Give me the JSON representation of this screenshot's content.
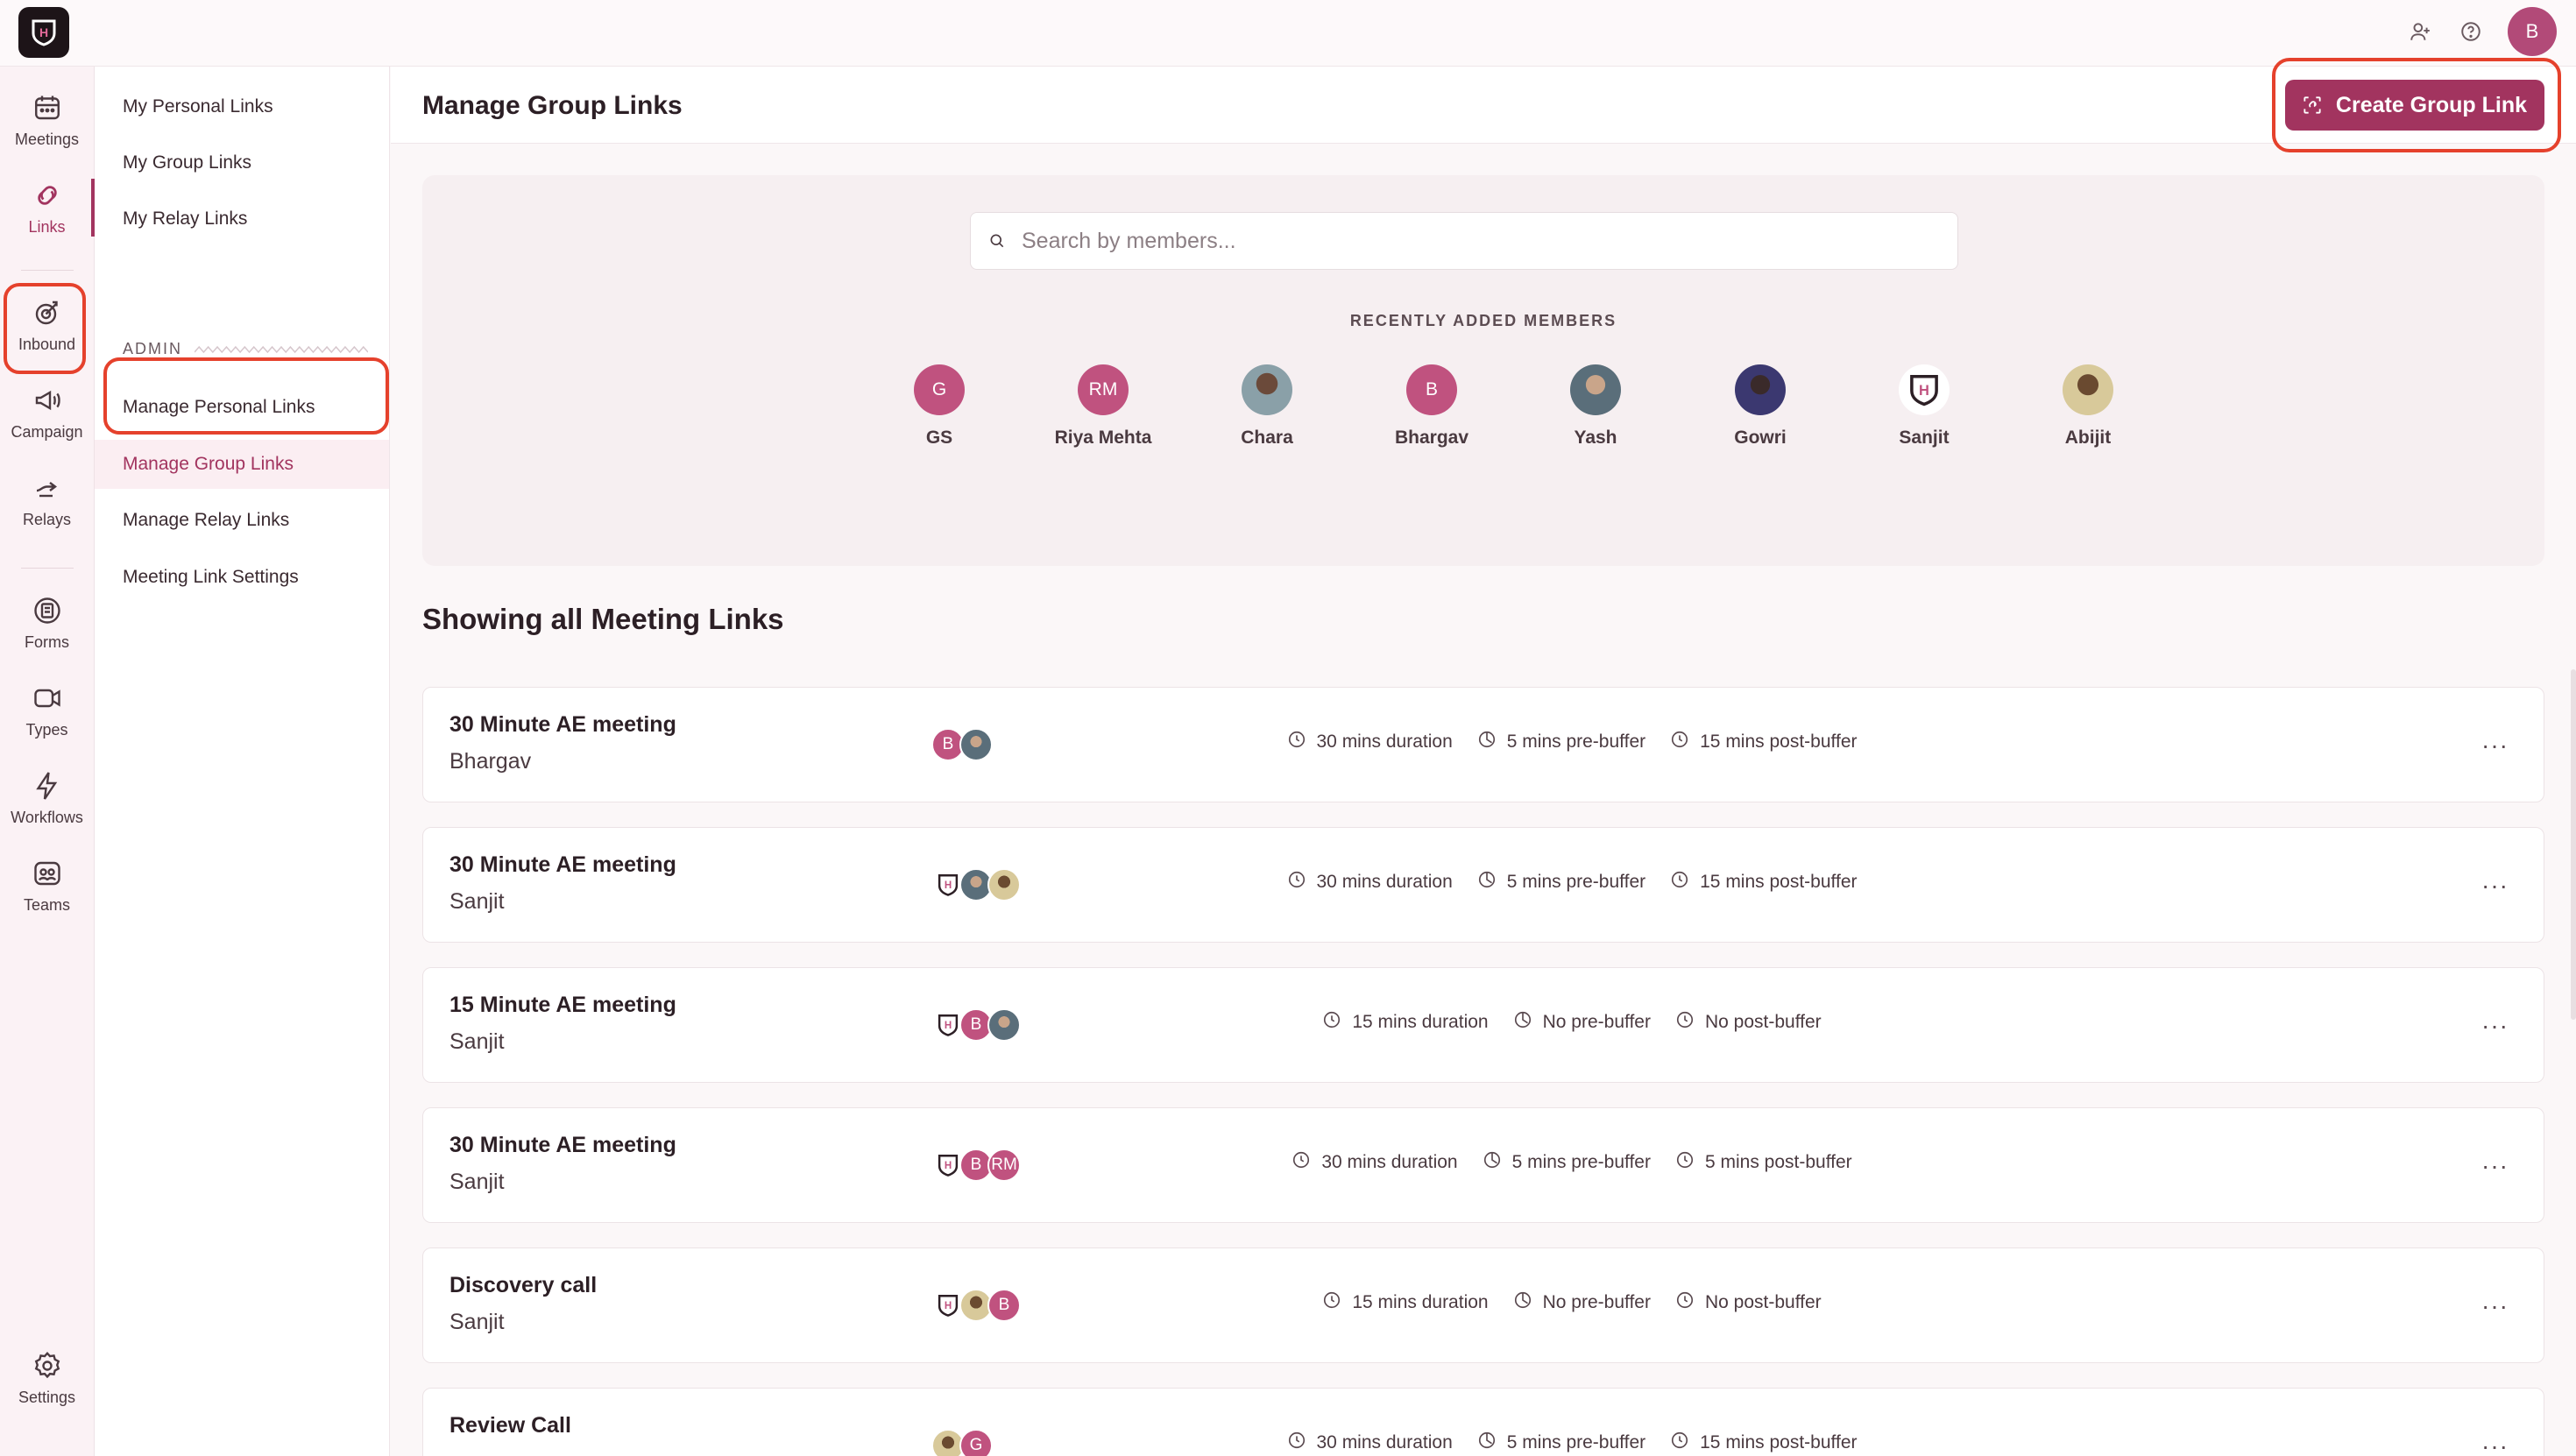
{
  "topbar": {
    "profile_initial": "B"
  },
  "rail": [
    {
      "label": "Meetings",
      "icon": "calendar-icon"
    },
    {
      "label": "Links",
      "icon": "link-icon",
      "active": true
    },
    {
      "label": "Inbound",
      "icon": "inbound-icon"
    },
    {
      "label": "Campaign",
      "icon": "megaphone-icon"
    },
    {
      "label": "Relays",
      "icon": "relay-icon"
    },
    {
      "label": "Forms",
      "icon": "forms-icon"
    },
    {
      "label": "Types",
      "icon": "video-icon"
    },
    {
      "label": "Workflows",
      "icon": "lightning-icon"
    },
    {
      "label": "Teams",
      "icon": "teams-icon"
    },
    {
      "label": "Settings",
      "icon": "gear-icon"
    }
  ],
  "subnav": {
    "items": [
      "My Personal Links",
      "My Group Links",
      "My Relay Links"
    ],
    "admin_label": "ADMIN",
    "admin_items": [
      "Manage Personal Links",
      "Manage Group Links",
      "Manage Relay Links",
      "Meeting Link Settings"
    ]
  },
  "header": {
    "title": "Manage Group Links",
    "create_label": "Create Group Link"
  },
  "search": {
    "placeholder": "Search by members..."
  },
  "recent": {
    "label": "RECENTLY ADDED MEMBERS",
    "members": [
      {
        "name": "GS",
        "initials": "G",
        "style": "pink"
      },
      {
        "name": "Riya Mehta",
        "initials": "RM",
        "style": "pink"
      },
      {
        "name": "Chara",
        "initials": "",
        "style": "photo1"
      },
      {
        "name": "Bhargav",
        "initials": "B",
        "style": "pink"
      },
      {
        "name": "Yash",
        "initials": "",
        "style": "photo2"
      },
      {
        "name": "Gowri",
        "initials": "",
        "style": "photo3"
      },
      {
        "name": "Sanjit",
        "initials": "",
        "style": "logoav"
      },
      {
        "name": "Abijit",
        "initials": "",
        "style": "photo4"
      }
    ]
  },
  "links_section_title": "Showing all Meeting Links",
  "links": [
    {
      "title": "30 Minute AE meeting",
      "owner": "Bhargav",
      "duration": "30 mins duration",
      "pre": "5 mins pre-buffer",
      "post": "15 mins post-buffer",
      "avatars": [
        {
          "style": "pink",
          "initials": "B"
        },
        {
          "style": "photo2",
          "initials": ""
        }
      ]
    },
    {
      "title": "30 Minute AE meeting",
      "owner": "Sanjit",
      "duration": "30 mins duration",
      "pre": "5 mins pre-buffer",
      "post": "15 mins post-buffer",
      "avatars": [
        {
          "style": "logoav",
          "initials": ""
        },
        {
          "style": "photo2",
          "initials": ""
        },
        {
          "style": "photo4",
          "initials": ""
        }
      ]
    },
    {
      "title": "15 Minute AE meeting",
      "owner": "Sanjit",
      "duration": "15 mins duration",
      "pre": "No pre-buffer",
      "post": "No post-buffer",
      "avatars": [
        {
          "style": "logoav",
          "initials": ""
        },
        {
          "style": "pink",
          "initials": "B"
        },
        {
          "style": "photo2",
          "initials": ""
        }
      ]
    },
    {
      "title": "30 Minute AE meeting",
      "owner": "Sanjit",
      "duration": "30 mins duration",
      "pre": "5 mins pre-buffer",
      "post": "5 mins post-buffer",
      "avatars": [
        {
          "style": "logoav",
          "initials": ""
        },
        {
          "style": "pink",
          "initials": "B"
        },
        {
          "style": "pink",
          "initials": "RM"
        }
      ]
    },
    {
      "title": "Discovery call",
      "owner": "Sanjit",
      "duration": "15 mins duration",
      "pre": "No pre-buffer",
      "post": "No post-buffer",
      "avatars": [
        {
          "style": "logoav",
          "initials": ""
        },
        {
          "style": "photo4",
          "initials": ""
        },
        {
          "style": "pink",
          "initials": "B"
        }
      ]
    },
    {
      "title": "Review Call",
      "owner": "",
      "duration": "30 mins duration",
      "pre": "5 mins pre-buffer",
      "post": "15 mins post-buffer",
      "avatars": [
        {
          "style": "photo4",
          "initials": ""
        },
        {
          "style": "pink",
          "initials": "G"
        }
      ]
    }
  ],
  "more_label": "···",
  "colors": {
    "accent": "#a2345f",
    "highlight": "#e5412c",
    "avatar_pink": "#c0527f"
  }
}
